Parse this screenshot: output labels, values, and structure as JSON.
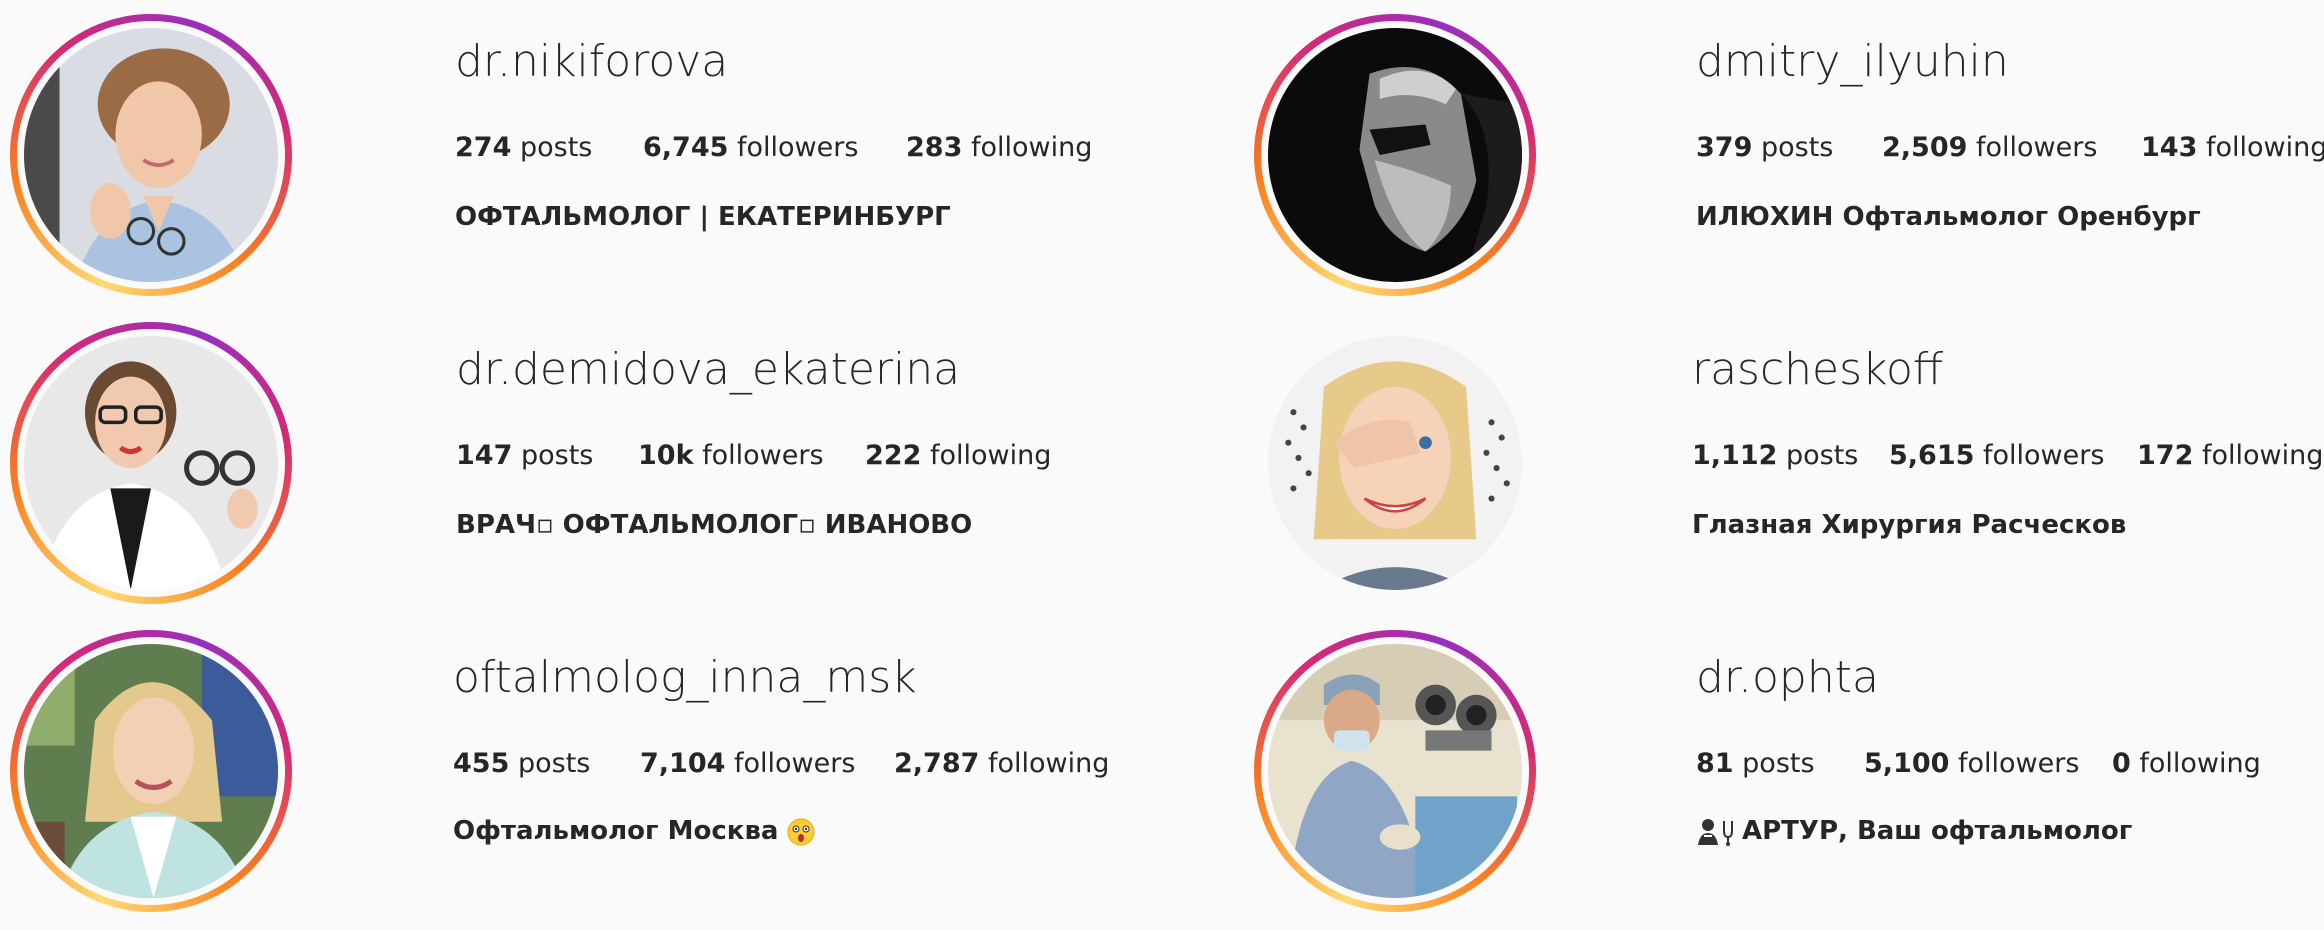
{
  "profiles": [
    {
      "username": "dr.nikiforova",
      "posts": "274",
      "posts_label": "posts",
      "followers": "6,745",
      "followers_label": "followers",
      "following": "283",
      "following_label": "following",
      "bio": "ОФТАЛЬМОЛОГ | ЕКАТЕРИНБУРГ",
      "story_ring": true
    },
    {
      "username": "dmitry_ilyuhin",
      "posts": "379",
      "posts_label": "posts",
      "followers": "2,509",
      "followers_label": "followers",
      "following": "143",
      "following_label": "following",
      "bio": "ИЛЮХИН Офтальмолог Оренбург",
      "story_ring": true
    },
    {
      "username": "dr.demidova_ekaterina",
      "posts": "147",
      "posts_label": "posts",
      "followers": "10k",
      "followers_label": "followers",
      "following": "222",
      "following_label": "following",
      "bio": "ВРАЧ▫ ОФТАЛЬМОЛОГ▫ ИВАНОВО",
      "story_ring": true
    },
    {
      "username": "rascheskoff",
      "posts": "1,112",
      "posts_label": "posts",
      "followers": "5,615",
      "followers_label": "followers",
      "following": "172",
      "following_label": "following",
      "bio": "Глазная Хирургия Расческов",
      "story_ring": false
    },
    {
      "username": "oftalmolog_inna_msk",
      "posts": "455",
      "posts_label": "posts",
      "followers": "7,104",
      "followers_label": "followers",
      "following": "2,787",
      "following_label": "following",
      "bio": "Офтальмолог Москва",
      "bio_emoji": "astonished-face-icon",
      "story_ring": true
    },
    {
      "username": "dr.ophta",
      "posts": "81",
      "posts_label": "posts",
      "followers": "5,100",
      "followers_label": "followers",
      "following": "0",
      "following_label": "following",
      "bio": "АРТУР, Ваш офтальмолог",
      "bio_icon": "doctor-stethoscope-icon",
      "story_ring": true
    }
  ],
  "colors": {
    "background": "#fafafa",
    "text": "#262626",
    "ring_gradient": [
      "#feda75",
      "#fa7e1e",
      "#d62976",
      "#962fbf"
    ]
  }
}
